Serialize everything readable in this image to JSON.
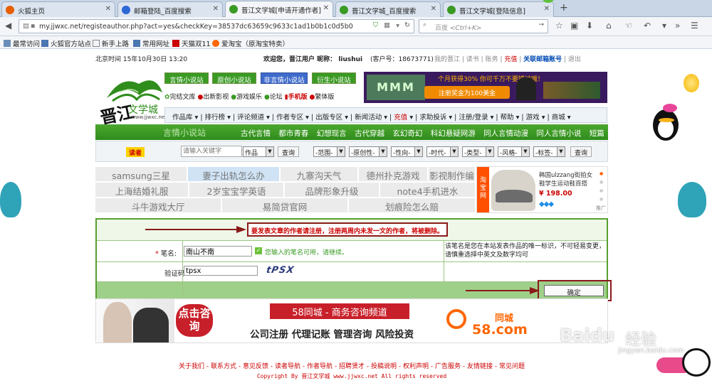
{
  "browser": {
    "tabs": [
      {
        "title": "火狐主页",
        "active": false
      },
      {
        "title": "邮箱登陆_百度搜索",
        "active": false
      },
      {
        "title": "晋江文学城[申请开通作者]",
        "active": true
      },
      {
        "title": "晋江文学城_百度搜索",
        "active": false
      },
      {
        "title": "晋江文学城[登陆信息]",
        "active": false
      }
    ],
    "new_tab": "+",
    "url": "my.jjwxc.net/registeauthor.php?act=yes&checkKey=38537dc63659c9633c1ad1b0b1c0d5b0",
    "search_engine": "百度",
    "search_placeholder": "<Ctrl+K>",
    "bookmarks": [
      "最常访问",
      "火狐官方站点",
      "新手上路",
      "常用网址",
      "天猫双11",
      "爱淘宝（原淘宝特卖）"
    ]
  },
  "topinfo": {
    "time_label": "北京时间",
    "time_value": "15年10月30日  13:20",
    "welcome": "欢迎您，晋江用户",
    "nick_label": "昵称：",
    "nick": "liushui",
    "client_no": "(客户号：18673771)",
    "links": [
      "我的晋江",
      "读书",
      "账务",
      "充值",
      "关联邮箱账号",
      "退出"
    ]
  },
  "site": {
    "logo_text": "晋江",
    "logo_sub": "文学城",
    "logo_url": "www.jjwxc.net",
    "channel_buttons": [
      "言情小说站",
      "原创小说站",
      "非言情小说站",
      "衍生小说站"
    ],
    "channel_links": [
      "完结文库",
      "出新影视",
      "游戏娱乐",
      "论坛",
      "手机版",
      "繁体版"
    ],
    "promo_line1": "个月获得30%",
    "promo_line2": "你可千万不要错过哦！",
    "promo_button": "注册奖金为100美金",
    "promo_logo": "MMM",
    "menu": [
      "作品库",
      "排行榜",
      "评论频道",
      "作者专区",
      "出版专区",
      "新闻活动",
      "充值",
      "求助投诉",
      "注册/登录",
      "帮助",
      "游戏",
      "商城"
    ],
    "green_title": "言情小说站",
    "green_links": [
      "古代言情",
      "都市青春",
      "幻想现言",
      "古代穿越",
      "玄幻奇幻",
      "科幻悬疑网游",
      "同人言情动漫",
      "同人言情小说",
      "短篇"
    ],
    "filter_badge": "读者",
    "search_placeholder": "请输入关键字",
    "search_type": "作品",
    "query_button": "查询",
    "filters": [
      "-范围-",
      "-原创性-",
      "-性向-",
      "-时代-",
      "-类型-",
      "-风格-",
      "-标签-"
    ],
    "query_button2": "查询"
  },
  "ads": {
    "row1": [
      "samsung三星",
      "妻子出轨怎么办",
      "九寨沟天气",
      "德州扑克游戏",
      "影视制作编"
    ],
    "row2": [
      "上海结婚礼服",
      "2岁宝宝学英语",
      "品牌形象升级",
      "note4手机进水"
    ],
    "row3": [
      "斗牛游戏大厅",
      "易简贷官网",
      "划痕险怎么赔"
    ],
    "taobao_label": "淘宝网",
    "product_title": "韩国ulzzang街拍女鞋学生运动鞋百搭",
    "product_price": "¥ 198.00",
    "ad_tag": "推广"
  },
  "form": {
    "notice": "要发表文章的作者请注册，注册两周内未发一文的作者，将被删除。",
    "penname_label": "笔名:",
    "penname_value": "南山不南",
    "penname_ok": "您输入的笔名可用，请继续。",
    "penname_help": "该笔名是您在本站发表作品的唯一标识，不可轻易变更，请慎重选择中英文及数字均可",
    "captcha_label": "验证码",
    "captcha_value": "tpsx",
    "captcha_image_text": "tPSX",
    "submit_label": "确定"
  },
  "sitead": {
    "bubble": "点击咨询",
    "title": "58同城 - 商务咨询频道",
    "services": "公司注册 代理记账 管理咨询 风险投资",
    "brand": "58.com",
    "brand_cn": "同城"
  },
  "footer": {
    "links": [
      "关于我们",
      "联系方式",
      "意见反馈",
      "读者导航",
      "作者导航",
      "招聘贤才",
      "投稿说明",
      "权利声明",
      "广告服务",
      "友情链接",
      "常见问题"
    ],
    "copyright": "Copyright By 晋江文学城 www.jjwxc.net All rights reserved"
  },
  "watermark": {
    "brand": "Baidu",
    "cn": "经验",
    "url": "jingyan.baidu.com"
  },
  "colors": {
    "green": "#3a9a24",
    "red": "#c00000",
    "dark_red": "#8b1a1a",
    "tab_bg": "#dbe4ef"
  }
}
